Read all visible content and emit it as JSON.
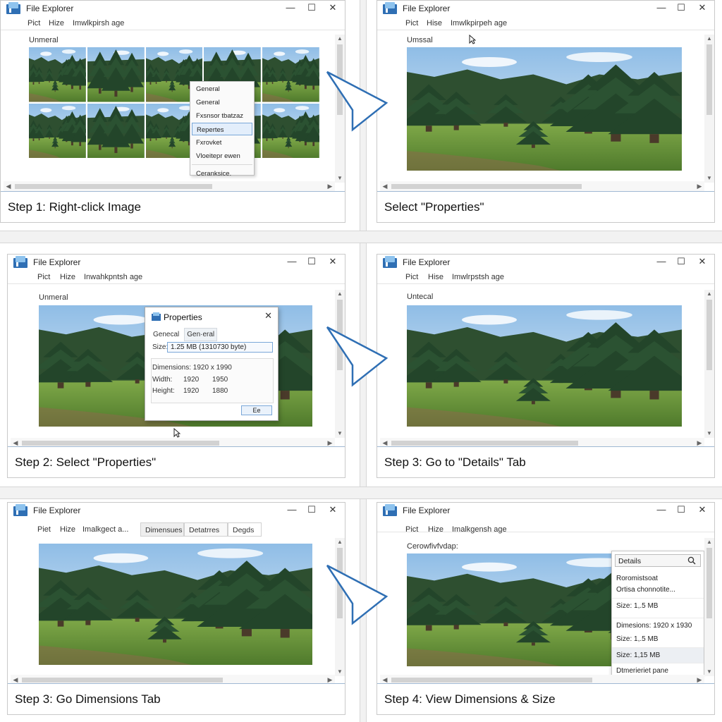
{
  "window": {
    "app_title": "File Explorer",
    "minimize": "—",
    "maximize": "☐",
    "close": "✕"
  },
  "colors": {
    "caption_border": "#9fb8d3",
    "accent": "#2f6fb4",
    "arrow": "#2f6fb4",
    "sky": "#bcd7ef",
    "forest": "#2e4f30",
    "meadow": "#6f9a3a"
  },
  "panels": [
    {
      "caption": "Step 1: Right-click Image",
      "menu": [
        "Pict",
        "Hize",
        "Imwlkpirsh age"
      ],
      "folder": "Unmeral",
      "context_menu": [
        "General",
        "General",
        "Fxsnsor tbatzaz",
        "Repertes",
        "Fxrovket",
        "Vloeitepr ewen",
        "Ceranksice."
      ],
      "context_menu_highlight": 3
    },
    {
      "caption": "Select \"Properties\"",
      "menu": [
        "Pict",
        "Hise",
        "Imwlkpirpeh age"
      ],
      "folder": "Umssal"
    },
    {
      "caption": "Step 2: Select \"Properties\"",
      "menu": [
        "Pict",
        "Hize",
        "Inwahkpntsh age"
      ],
      "folder": "Unmeral",
      "dialog": {
        "title": "Properties",
        "close": "✕",
        "tabs": [
          "Genecal",
          "Gen·eral"
        ],
        "size_label": "Size:",
        "size_value": "1.25 MB (1310730 byte)",
        "dimensions": "Dimensions: 1920 x 1990",
        "width_label": "Width:",
        "width_a": "1920",
        "width_b": "1950",
        "height_label": "Height:",
        "height_a": "1920",
        "height_b": "1880",
        "ok": "Ee"
      }
    },
    {
      "caption": "Step 3: Go to \"Details\" Tab",
      "menu": [
        "Pict",
        "Hise",
        "Imwlrpstsh age"
      ],
      "folder": "Untecal"
    },
    {
      "caption": "Step 3: Go Dimensions Tab",
      "menu": [
        "Piet",
        "Hize",
        "Imalkgect a..."
      ],
      "tabs": [
        "Dimensues",
        "Detatrres",
        "Degds"
      ]
    },
    {
      "caption": "Step 4: View Dimensions & Size",
      "menu": [
        "Pict",
        "Hize",
        "Imalkgensh age"
      ],
      "folder": "Cerowfivfvdap:",
      "details": {
        "header": "Details",
        "rows": [
          "Roromistsoat",
          "Ortisa chonnotite...",
          "Size: 1,.5 MB",
          "Dimesions: 1920 x 1930",
          "Size: 1,.5 MB",
          "Size: 1,15 MB",
          "Dtmerieriet pane"
        ],
        "highlight": 5
      }
    }
  ]
}
